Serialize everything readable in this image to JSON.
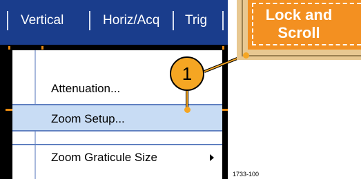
{
  "menubar": {
    "items": [
      "Vertical",
      "Horiz/Acq",
      "Trig"
    ]
  },
  "dropdown": {
    "items": [
      "Attenuation...",
      "Zoom Setup...",
      "Zoom Graticule Size"
    ],
    "selected": "Zoom Setup..."
  },
  "button": {
    "lines": [
      "Lock and",
      "Scroll"
    ]
  },
  "callout": {
    "number": "1"
  },
  "figure_id": "1733-100",
  "colors": {
    "menubar": "#1a3d8c",
    "button": "#f39021",
    "callout": "#f5a623",
    "selected_row": "#c8dcf4"
  }
}
